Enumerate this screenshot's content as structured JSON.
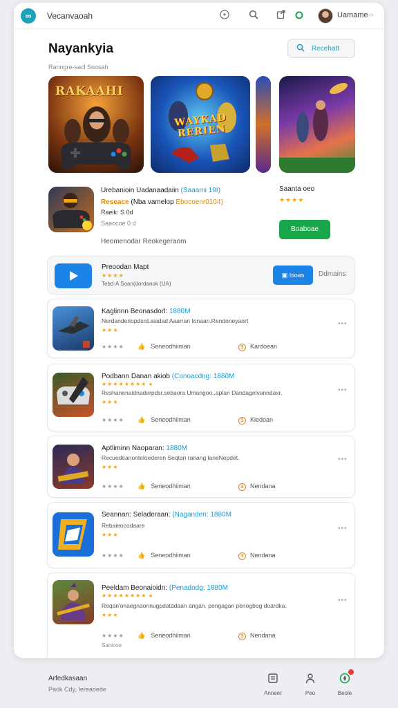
{
  "header": {
    "logo_glyph": "∞",
    "app_name": "Vecanvaoah",
    "icons": [
      "compass-icon",
      "search-icon",
      "share-icon",
      "status-dot-icon"
    ],
    "user_name": "Uamame",
    "user_chevron": "‹›"
  },
  "page": {
    "title": "Nayankyia",
    "subtitle": "Ranngre-sacl Snosah",
    "search_label": "Recehatt"
  },
  "featured": [
    {
      "label": "RAKAAHI",
      "name": "featured-rakaahi"
    },
    {
      "label": "WAYKAD RERIEN",
      "name": "featured-waykad"
    },
    {
      "label": "",
      "name": "featured-strip"
    },
    {
      "label": "",
      "name": "featured-scifi"
    }
  ],
  "promo": {
    "title": "Urebanioin Uadanaadaiin",
    "title_accent": "(Saaami 19I)",
    "line2_prefix": "Reseace",
    "line2_mid": "(Nba vamelop",
    "line2_amount": "Ebocoenr0104)",
    "line3": "Raeik: S 0d",
    "line4": "Saaocoe 0 d",
    "recommend": "Heomenodar Reokegeraom",
    "side_name": "Saanta oeo",
    "side_stars": "★★★★",
    "side_button": "Boaboae"
  },
  "play_row": {
    "name": "Preoodan Mapt",
    "stars": "★★★★",
    "desc": "Tebd-A Soan(dordanok (UA)",
    "button": "Isoas",
    "link": "Ddmains"
  },
  "apps": [
    {
      "title": "Kaglinnn Beonasdorl:",
      "price": "1880M",
      "stars": "★★★",
      "desc": "Nerdanderiopdsrd.aiadad Aaarran tonaan.Rendoneyaort",
      "rating": "★★★★",
      "tag": "Seneodhiiman",
      "more": "Kardoean"
    },
    {
      "title": "Podbann Danan akiob",
      "price": "(Conoacdng: 1880M",
      "stars": "★★★★★★★★",
      "stars2": "★★★",
      "desc": "Reshanenaidnaderpdsr.sebaora Umangoo..aplan Dandagelvanndaxr.",
      "rating": "★★★★",
      "tag": "Seneodhiiman",
      "more": "Kiedoan"
    },
    {
      "title": "Aptliminn Naoparan:",
      "price": "1880M",
      "stars": "★★★",
      "desc": "Recuedeanonteloederen Seqtan ranang laneNepdet.",
      "rating": "★★★★",
      "tag": "Seneodhiiman",
      "more": "Nendana"
    },
    {
      "title": "Seannan: Seladeraan:",
      "price": "(Naganden: 1880M",
      "stars": "★★★",
      "desc": "Rebaieocodaare",
      "rating": "★★★★",
      "tag": "Seneodhiiman",
      "more": "Nendana"
    },
    {
      "title": "Peeldam Beonaioidn:",
      "price": "(Penadodg: 1880M",
      "stars": "★★★★★★★★",
      "stars2": "★★★",
      "desc": "Reqan'onaegnaonnugpdatadaan angan. pengagan penogbog doardka.",
      "rating": "★★★★",
      "tag": "Seneodhiiman",
      "more": "Nendana",
      "extra": "Sanicoo"
    }
  ],
  "footer": {
    "line1": "Arfedkasaan",
    "line2": "Paok Cdy, Iereaoede"
  },
  "bottom_nav": [
    {
      "label": "Anneer",
      "icon": "library-icon"
    },
    {
      "label": "Peo",
      "icon": "person-icon"
    },
    {
      "label": "Beole",
      "icon": "compass-icon"
    }
  ],
  "colors": {
    "accent": "#19a2b8",
    "button_green": "#17a649",
    "button_blue": "#1b84e6",
    "star": "#f0a51a"
  }
}
